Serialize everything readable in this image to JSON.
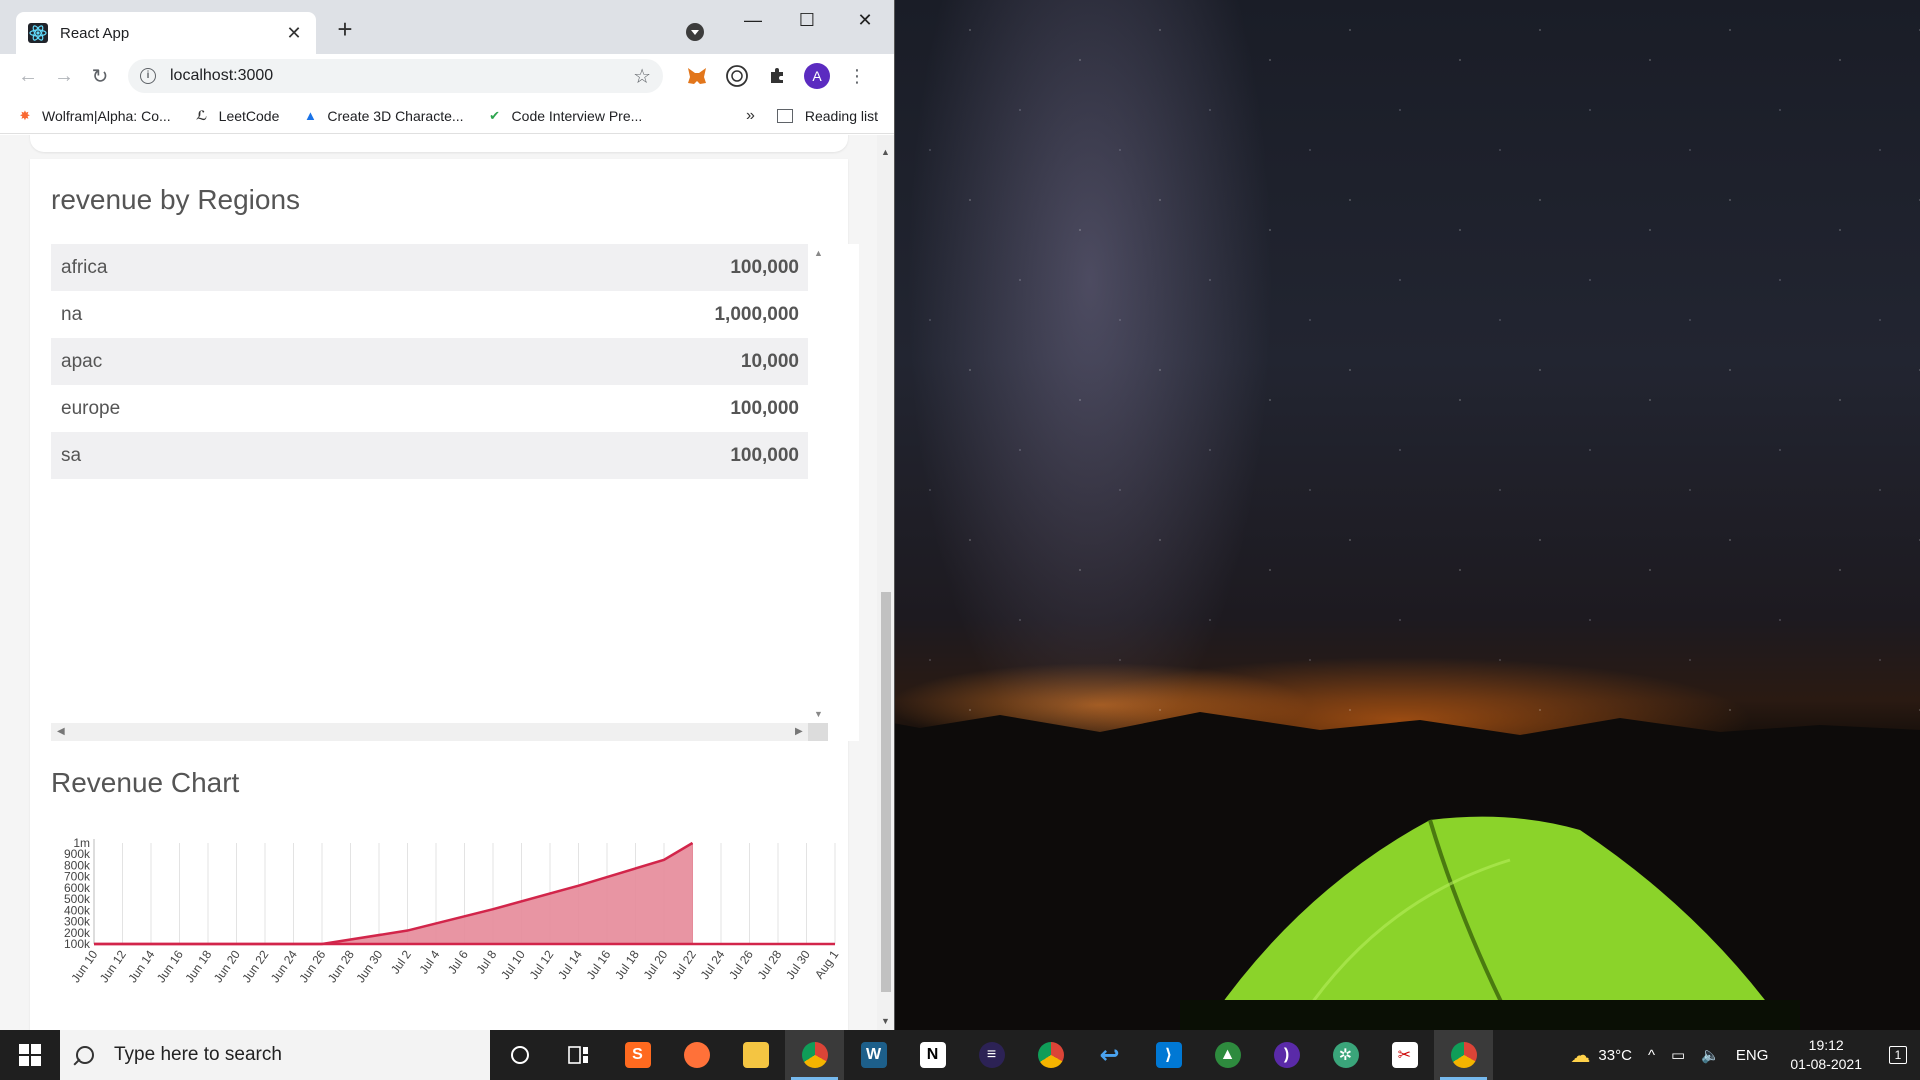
{
  "browser": {
    "tab_title": "React App",
    "url": "localhost:3000",
    "bookmarks": [
      {
        "label": "Wolfram|Alpha: Co...",
        "icon": "wolfram-icon"
      },
      {
        "label": "LeetCode",
        "icon": "leetcode-icon"
      },
      {
        "label": "Create 3D Characte...",
        "icon": "adobe-icon"
      },
      {
        "label": "Code Interview Pre...",
        "icon": "check-icon"
      }
    ],
    "overflow_label": "»",
    "reading_list_label": "Reading list",
    "profile_initial": "A"
  },
  "page": {
    "regions_title": "revenue by Regions",
    "regions": [
      {
        "name": "africa",
        "value": "100,000"
      },
      {
        "name": "na",
        "value": "1,000,000"
      },
      {
        "name": "apac",
        "value": "10,000"
      },
      {
        "name": "europe",
        "value": "100,000"
      },
      {
        "name": "sa",
        "value": "100,000"
      }
    ],
    "chart_title": "Revenue Chart"
  },
  "chart_data": {
    "type": "area",
    "title": "Revenue Chart",
    "xlabel": "",
    "ylabel": "",
    "x_ticks": [
      "Jun 10",
      "Jun 12",
      "Jun 14",
      "Jun 16",
      "Jun 18",
      "Jun 20",
      "Jun 22",
      "Jun 24",
      "Jun 26",
      "Jun 28",
      "Jun 30",
      "Jul 2",
      "Jul 4",
      "Jul 6",
      "Jul 8",
      "Jul 10",
      "Jul 12",
      "Jul 14",
      "Jul 16",
      "Jul 18",
      "Jul 20",
      "Jul 22",
      "Jul 24",
      "Jul 26",
      "Jul 28",
      "Jul 30",
      "Aug 1"
    ],
    "y_ticks": [
      "100k",
      "200k",
      "300k",
      "400k",
      "500k",
      "600k",
      "700k",
      "800k",
      "900k",
      "1m"
    ],
    "ylim": [
      100000,
      1000000
    ],
    "series": [
      {
        "color": "#d2254a",
        "fill": "#e68a99",
        "x": [
          "Jun 10",
          "Jun 26",
          "Jul 2",
          "Jul 8",
          "Jul 14",
          "Jul 20",
          "Jul 22"
        ],
        "y": [
          100000,
          100000,
          220000,
          410000,
          620000,
          850000,
          1000000
        ]
      }
    ],
    "baseline_line": {
      "from": "Jun 10",
      "to": "Aug 1",
      "y": 100000
    },
    "grid": true
  },
  "taskbar": {
    "search_placeholder": "Type here to search",
    "weather": "33°C",
    "language": "ENG",
    "time": "19:12",
    "date": "01-08-2021",
    "notification_count": "1"
  }
}
